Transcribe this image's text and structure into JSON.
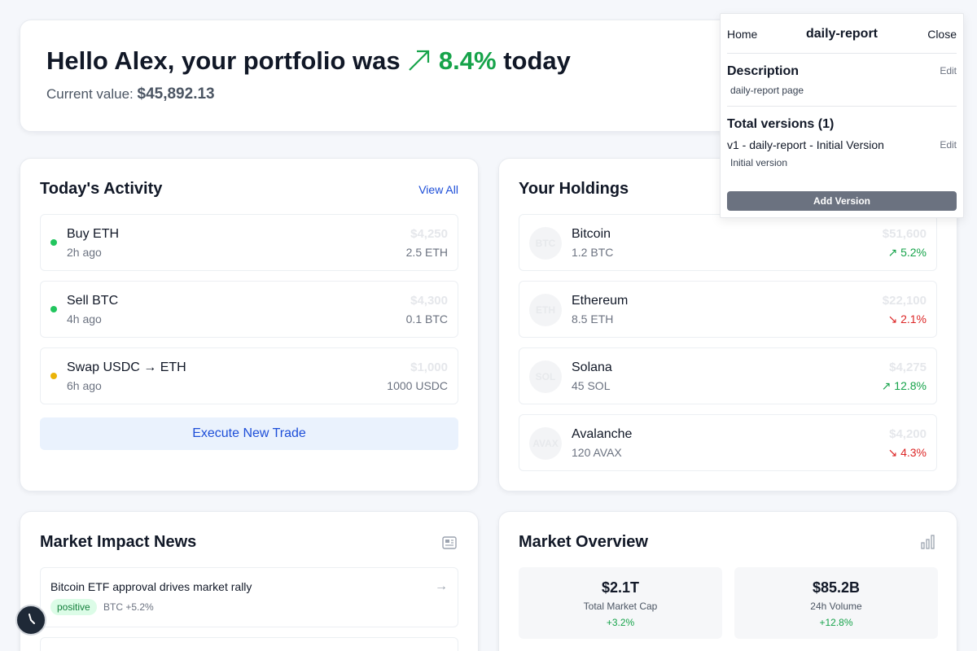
{
  "hero": {
    "greeting": "Hello Alex, your portfolio was",
    "change": "8.4%",
    "suffix": "today",
    "value_label": "Current value:",
    "value": "$45,892.13"
  },
  "activity": {
    "title": "Today's Activity",
    "view_all": "View All",
    "items": [
      {
        "title": "Buy ETH",
        "time": "2h ago",
        "amount": "$4,250",
        "qty": "2.5 ETH",
        "status_color": "#22c55e"
      },
      {
        "title": "Sell BTC",
        "time": "4h ago",
        "amount": "$4,300",
        "qty": "0.1 BTC",
        "status_color": "#22c55e"
      },
      {
        "title": "Swap USDC → ETH",
        "time": "6h ago",
        "amount": "$1,000",
        "qty": "1000 USDC",
        "status_color": "#eab308"
      }
    ],
    "execute_button": "Execute New Trade"
  },
  "holdings": {
    "title": "Your Holdings",
    "items": [
      {
        "symbol": "BTC",
        "name": "Bitcoin",
        "qty": "1.2 BTC",
        "value": "$51,600",
        "change": "↗ 5.2%",
        "direction": "up"
      },
      {
        "symbol": "ETH",
        "name": "Ethereum",
        "qty": "8.5 ETH",
        "value": "$22,100",
        "change": "↘ 2.1%",
        "direction": "down"
      },
      {
        "symbol": "SOL",
        "name": "Solana",
        "qty": "45 SOL",
        "value": "$4,275",
        "change": "↗ 12.8%",
        "direction": "up"
      },
      {
        "symbol": "AVAX",
        "name": "Avalanche",
        "qty": "120 AVAX",
        "value": "$4,200",
        "change": "↘ 4.3%",
        "direction": "down"
      }
    ]
  },
  "news": {
    "title": "Market Impact News",
    "items": [
      {
        "headline": "Bitcoin ETF approval drives market rally",
        "sentiment": "positive",
        "meta": "BTC +5.2%"
      }
    ]
  },
  "overview": {
    "title": "Market Overview",
    "stats": [
      {
        "value": "$2.1T",
        "label": "Total Market Cap",
        "change": "+3.2%"
      },
      {
        "value": "$85.2B",
        "label": "24h Volume",
        "change": "+12.8%"
      }
    ]
  },
  "panel": {
    "home": "Home",
    "title": "daily-report",
    "close": "Close",
    "description_heading": "Description",
    "description_edit": "Edit",
    "description": "daily-report page",
    "versions_heading": "Total versions (1)",
    "version_label": "v1 - daily-report - Initial Version",
    "version_edit": "Edit",
    "version_note": "Initial version",
    "add_button": "Add Version"
  },
  "colors": {
    "up": "#16a34a",
    "down": "#dc2626",
    "accent": "#1d4ed8"
  }
}
